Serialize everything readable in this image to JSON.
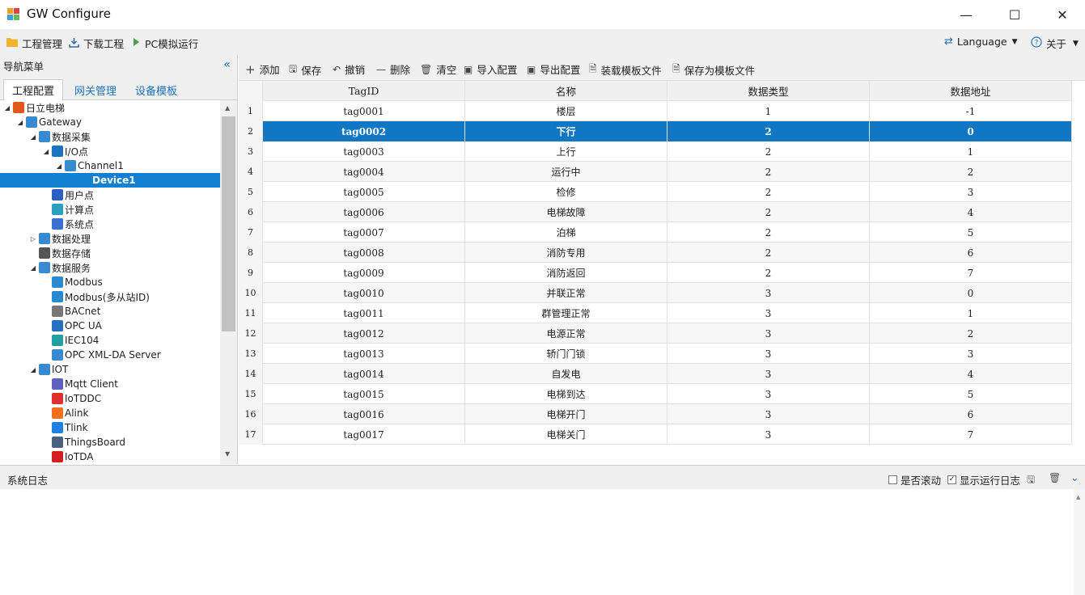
{
  "window": {
    "title": "GW Configure",
    "minimize": "—",
    "maximize": "☐",
    "close": "✕"
  },
  "menubar": {
    "project": "工程管理",
    "download": "下载工程",
    "simulate": "PC模拟运行",
    "language": "Language",
    "about": "关于"
  },
  "nav": {
    "title": "导航菜单",
    "tabs": [
      "工程配置",
      "网关管理",
      "设备模板"
    ],
    "tree": [
      {
        "label": "日立电梯",
        "level": 0,
        "arrow": "◢",
        "icon": "layers-icon"
      },
      {
        "label": "Gateway",
        "level": 1,
        "arrow": "◢",
        "icon": "gateway-icon"
      },
      {
        "label": "数据采集",
        "level": 2,
        "arrow": "◢",
        "icon": "chart-icon"
      },
      {
        "label": "I/O点",
        "level": 3,
        "arrow": "◢",
        "icon": "io-icon"
      },
      {
        "label": "Channel1",
        "level": 4,
        "arrow": "◢",
        "icon": "network-icon"
      },
      {
        "label": "Device1",
        "level": 5,
        "arrow": "",
        "icon": "",
        "selected": true
      },
      {
        "label": "用户点",
        "level": 3,
        "arrow": "",
        "icon": "user-point-icon"
      },
      {
        "label": "计算点",
        "level": 3,
        "arrow": "",
        "icon": "calc-icon"
      },
      {
        "label": "系统点",
        "level": 3,
        "arrow": "",
        "icon": "system-icon"
      },
      {
        "label": "数据处理",
        "level": 2,
        "arrow": "▷",
        "icon": "process-icon"
      },
      {
        "label": "数据存储",
        "level": 2,
        "arrow": "",
        "icon": "database-icon"
      },
      {
        "label": "数据服务",
        "level": 2,
        "arrow": "◢",
        "icon": "service-icon"
      },
      {
        "label": "Modbus",
        "level": 3,
        "arrow": "",
        "icon": "modbus-icon"
      },
      {
        "label": "Modbus(多从站ID)",
        "level": 3,
        "arrow": "",
        "icon": "modbus-icon"
      },
      {
        "label": "BACnet",
        "level": 3,
        "arrow": "",
        "icon": "bacnet-icon"
      },
      {
        "label": "OPC UA",
        "level": 3,
        "arrow": "",
        "icon": "opcua-icon"
      },
      {
        "label": "IEC104",
        "level": 3,
        "arrow": "",
        "icon": "iec104-icon"
      },
      {
        "label": "OPC XML-DA Server",
        "level": 3,
        "arrow": "",
        "icon": "opcxml-icon"
      },
      {
        "label": "IOT",
        "level": 2,
        "arrow": "◢",
        "icon": "iot-icon"
      },
      {
        "label": "Mqtt Client",
        "level": 3,
        "arrow": "",
        "icon": "mqtt-icon"
      },
      {
        "label": "IoTDDC",
        "level": 3,
        "arrow": "",
        "icon": "iotddc-icon"
      },
      {
        "label": "Alink",
        "level": 3,
        "arrow": "",
        "icon": "alink-icon"
      },
      {
        "label": "Tlink",
        "level": 3,
        "arrow": "",
        "icon": "tlink-icon"
      },
      {
        "label": "ThingsBoard",
        "level": 3,
        "arrow": "",
        "icon": "thingsboard-icon"
      },
      {
        "label": "IoTDA",
        "level": 3,
        "arrow": "",
        "icon": "huawei-icon"
      }
    ]
  },
  "toolbar": {
    "add": "添加",
    "save": "保存",
    "undo": "撤销",
    "delete": "删除",
    "clear": "清空",
    "import": "导入配置",
    "export": "导出配置",
    "load_template": "装载模板文件",
    "save_template": "保存为模板文件"
  },
  "table": {
    "columns": [
      "TagID",
      "名称",
      "数据类型",
      "数据地址"
    ],
    "rows": [
      [
        "1",
        "tag0001",
        "楼层",
        "1",
        "-1"
      ],
      [
        "2",
        "tag0002",
        "下行",
        "2",
        "0"
      ],
      [
        "3",
        "tag0003",
        "上行",
        "2",
        "1"
      ],
      [
        "4",
        "tag0004",
        "运行中",
        "2",
        "2"
      ],
      [
        "5",
        "tag0005",
        "检修",
        "2",
        "3"
      ],
      [
        "6",
        "tag0006",
        "电梯故障",
        "2",
        "4"
      ],
      [
        "7",
        "tag0007",
        "泊梯",
        "2",
        "5"
      ],
      [
        "8",
        "tag0008",
        "消防专用",
        "2",
        "6"
      ],
      [
        "9",
        "tag0009",
        "消防返回",
        "2",
        "7"
      ],
      [
        "10",
        "tag0010",
        "并联正常",
        "3",
        "0"
      ],
      [
        "11",
        "tag0011",
        "群管理正常",
        "3",
        "1"
      ],
      [
        "12",
        "tag0012",
        "电源正常",
        "3",
        "2"
      ],
      [
        "13",
        "tag0013",
        "轿门门锁",
        "3",
        "3"
      ],
      [
        "14",
        "tag0014",
        "自发电",
        "3",
        "4"
      ],
      [
        "15",
        "tag0015",
        "电梯到达",
        "3",
        "5"
      ],
      [
        "16",
        "tag0016",
        "电梯开门",
        "3",
        "6"
      ],
      [
        "17",
        "tag0017",
        "电梯关门",
        "3",
        "7"
      ]
    ],
    "selected_row": 2
  },
  "log": {
    "title": "系统日志",
    "auto_scroll": "是否滚动",
    "show_runtime": "显示运行日志"
  },
  "colors": {
    "selection": "#1177c2",
    "accent": "#1e73be"
  }
}
